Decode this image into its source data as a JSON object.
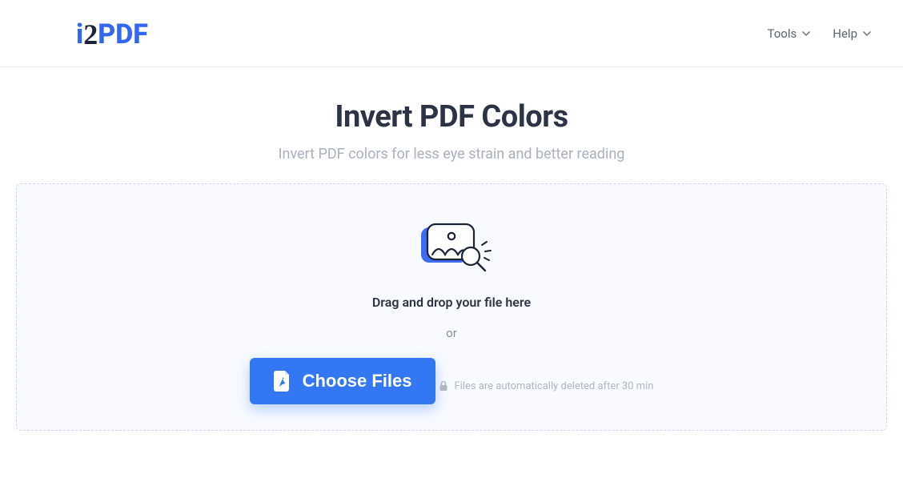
{
  "nav": {
    "tools": "Tools",
    "help": "Help"
  },
  "hero": {
    "title": "Invert PDF Colors",
    "subtitle": "Invert PDF colors for less eye strain and better reading"
  },
  "drop": {
    "drag_text": "Drag and drop your file here",
    "or": "or",
    "choose_label": "Choose Files",
    "delete_note": "Files are automatically deleted after 30 min"
  }
}
